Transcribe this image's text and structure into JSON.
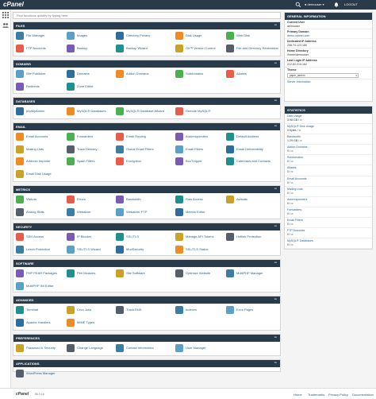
{
  "topbar": {
    "logo": "cPanel",
    "user": "demouser",
    "logout": "LOGOUT"
  },
  "search": {
    "placeholder": "Find functions quickly by typing here."
  },
  "panels": [
    {
      "title": "FILES",
      "items": [
        "File Manager",
        "Images",
        "Directory Privacy",
        "Disk Usage",
        "Web Disk",
        "FTP Accounts",
        "Backup",
        "Backup Wizard",
        "Git™ Version Control",
        "File and Directory Restoration"
      ]
    },
    {
      "title": "DOMAINS",
      "items": [
        "Site Publisher",
        "Domains",
        "Addon Domains",
        "Subdomains",
        "Aliases",
        "Redirects",
        "Zone Editor"
      ]
    },
    {
      "title": "DATABASES",
      "items": [
        "phpMyAdmin",
        "MySQL® Databases",
        "MySQL® Database Wizard",
        "Remote MySQL®"
      ]
    },
    {
      "title": "EMAIL",
      "items": [
        "Email Accounts",
        "Forwarders",
        "Email Routing",
        "Autoresponders",
        "Default Address",
        "Mailing Lists",
        "Track Delivery",
        "Global Email Filters",
        "Email Filters",
        "Email Deliverability",
        "Address Importer",
        "Spam Filters",
        "Encryption",
        "BoxTrapper",
        "Calendars and Contacts",
        "Email Disk Usage"
      ]
    },
    {
      "title": "METRICS",
      "items": [
        "Visitors",
        "Errors",
        "Bandwidth",
        "Raw Access",
        "Awstats",
        "Analog Stats",
        "Webalizer",
        "Webalizer FTP",
        "Metrics Editor"
      ]
    },
    {
      "title": "SECURITY",
      "items": [
        "SSH Access",
        "IP Blocker",
        "SSL/TLS",
        "Manage API Tokens",
        "Hotlink Protection",
        "Leech Protection",
        "SSL/TLS Wizard",
        "ModSecurity",
        "SSL/TLS Status"
      ]
    },
    {
      "title": "SOFTWARE",
      "items": [
        "PHP PEAR Packages",
        "Perl Modules",
        "Site Software",
        "Optimize Website",
        "MultiPHP Manager",
        "MultiPHP INI Editor"
      ]
    },
    {
      "title": "ADVANCED",
      "items": [
        "Terminal",
        "Cron Jobs",
        "Track DNS",
        "Indexes",
        "Error Pages",
        "Apache Handlers",
        "MIME Types"
      ]
    },
    {
      "title": "PREFERENCES",
      "items": [
        "Password & Security",
        "Change Language",
        "Contact Information",
        "User Manager"
      ]
    },
    {
      "title": "APPLICATIONS",
      "items": [
        "WordPress Manager"
      ]
    }
  ],
  "general": {
    "title": "GENERAL INFORMATION",
    "current_user_label": "Current User",
    "current_user": "demouser",
    "primary_domain_label": "Primary Domain",
    "primary_domain": "demo.cpanel.com",
    "ip_label": "Dedicated IP Address",
    "ip": "208.74.123.180",
    "home_label": "Home Directory",
    "home": "/home/demouser",
    "last_login_label": "Last Login IP Address",
    "last_login": "212.82.219.162",
    "theme_label": "Theme",
    "theme": "paper_lantern",
    "server_info": "Server Information"
  },
  "statistics": {
    "title": "STATISTICS",
    "rows": [
      {
        "label": "Disk Usage",
        "value": "3.98 GB / ∞"
      },
      {
        "label": "MySQL® Disk Usage",
        "value": "0 bytes / ∞"
      },
      {
        "label": "Bandwidth",
        "value": "1.29 GB / ∞"
      },
      {
        "label": "Addon Domains",
        "value": "0 / ∞"
      },
      {
        "label": "Subdomains",
        "value": "0 / ∞"
      },
      {
        "label": "Aliases",
        "value": "0 / ∞"
      },
      {
        "label": "Email Accounts",
        "value": "0 / ∞"
      },
      {
        "label": "Mailing Lists",
        "value": "0 / ∞"
      },
      {
        "label": "Autoresponders",
        "value": "0 / ∞"
      },
      {
        "label": "Forwarders",
        "value": "0 / ∞"
      },
      {
        "label": "Email Filters",
        "value": "0 / ∞"
      },
      {
        "label": "FTP Accounts",
        "value": "0 / ∞"
      },
      {
        "label": "MySQL® Databases",
        "value": "0 / ∞"
      }
    ]
  },
  "footer": {
    "logo": "cPanel",
    "version": "86.0.16",
    "links": [
      "Home",
      "Trademarks",
      "Privacy Policy",
      "Documentation"
    ]
  },
  "colors": {
    "navbar": "#293a4a",
    "link": "#1f5d8b",
    "accent": "#ff6c2c"
  }
}
